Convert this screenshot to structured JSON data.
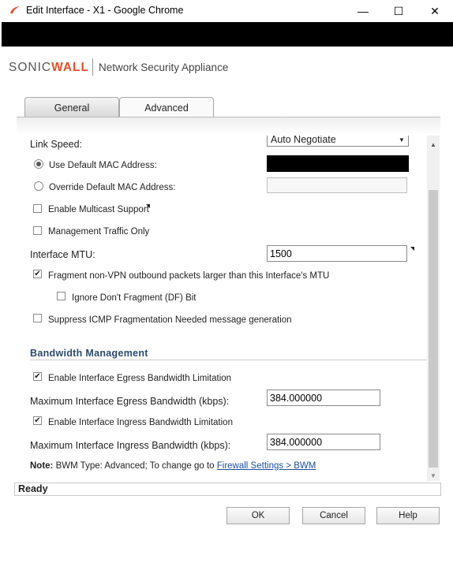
{
  "window": {
    "title": "Edit Interface - X1 - Google Chrome",
    "minimize_glyph": "—",
    "maximize_glyph": "☐",
    "close_glyph": "✕"
  },
  "header": {
    "brand_accent_part": "SONIC",
    "brand_dark_part": "WALL",
    "product_name": "Network Security Appliance"
  },
  "tabs": [
    {
      "label": "General",
      "active": false
    },
    {
      "label": "Advanced",
      "active": true
    }
  ],
  "form": {
    "link_speed_label": "Link Speed:",
    "link_speed_value": "Auto Negotiate",
    "use_default_mac_label": "Use Default MAC Address:",
    "use_default_mac_selected": true,
    "override_mac_label": "Override Default MAC Address:",
    "override_mac_selected": false,
    "multicast_label": "Enable Multicast Support",
    "multicast_checked": false,
    "mgmt_traffic_label": "Management Traffic Only",
    "mgmt_traffic_checked": false,
    "mtu_label": "Interface MTU:",
    "mtu_value": "1500",
    "fragment_label": "Fragment non-VPN outbound packets larger than this Interface's MTU",
    "fragment_checked": true,
    "ignore_df_label": "Ignore Don't Fragment (DF) Bit",
    "ignore_df_checked": false,
    "suppress_icmp_label": "Suppress ICMP Fragmentation Needed message generation",
    "suppress_icmp_checked": false
  },
  "bandwidth": {
    "section_title": "Bandwidth Management",
    "egress_enable_label": "Enable Interface Egress Bandwidth Limitation",
    "egress_enable_checked": true,
    "egress_max_label": "Maximum Interface Egress Bandwidth (kbps):",
    "egress_max_value": "384.000000",
    "ingress_enable_label": "Enable Interface Ingress Bandwidth Limitation",
    "ingress_enable_checked": true,
    "ingress_max_label": "Maximum Interface Ingress Bandwidth (kbps):",
    "ingress_max_value": "384.000000",
    "note_label": "Note:",
    "note_text": "BWM Type: Advanced; To change go to",
    "note_link": "Firewall Settings > BWM"
  },
  "status": {
    "text": "Ready"
  },
  "buttons": {
    "ok": "OK",
    "cancel": "Cancel",
    "help": "Help"
  },
  "glyphs": {
    "check": "✔",
    "dropdown_arrow": "▼",
    "scroll_up": "▲",
    "scroll_down": "▼"
  },
  "colors": {
    "brand_accent": "#e0522b",
    "section_title": "#2d4a6b",
    "link": "#1c4fa3"
  }
}
